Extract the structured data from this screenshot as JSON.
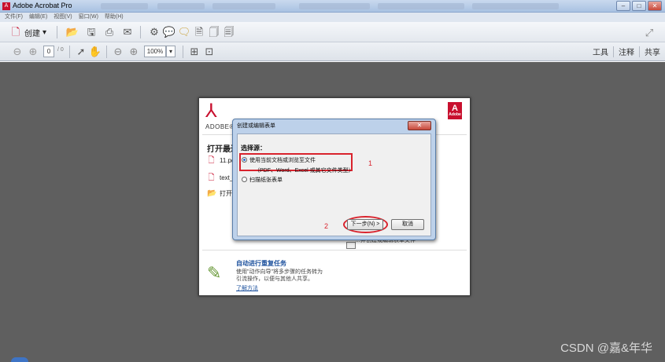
{
  "window": {
    "title": "Adobe Acrobat Pro",
    "min": "–",
    "max": "□",
    "close": "✕"
  },
  "menu": [
    "文件(F)",
    "编辑(E)",
    "视图(V)",
    "窗口(W)",
    "帮助(H)"
  ],
  "toolbar": {
    "create_label": "创建",
    "create_caret": "▾"
  },
  "nav": {
    "page_value": "0",
    "page_total": "/ 0",
    "zoom_value": "100%",
    "zoom_caret": "▾"
  },
  "right_tools": {
    "tools": "工具",
    "comment": "注释",
    "share": "共享"
  },
  "welcome": {
    "brand": "ADOBE® A",
    "badge": "Adobe",
    "open_recent": "打开最近",
    "recent_files": [
      "11.pd",
      "text_s",
      "打开..."
    ],
    "behind_text": "…并创建或编辑表单文件",
    "task_title": "自动进行重复任务",
    "task_desc": "使用\"动作向导\"将多步骤的任务转为\n引流操作，以便与其他人共享。",
    "task_link": "了解方法"
  },
  "dialog": {
    "title": "创建或编辑表单",
    "close": "✕",
    "source_label": "选择源：",
    "option1": "使用当前文档或浏览至文件",
    "option1_sub": "（PDF、Word、Excel 或其它文件类型）",
    "option2": "扫描纸张表单",
    "next_button": "下一步(N) >",
    "cancel_button": "取消",
    "annotation1": "1",
    "annotation2": "2"
  },
  "watermark": "CSDN @嘉&年华"
}
